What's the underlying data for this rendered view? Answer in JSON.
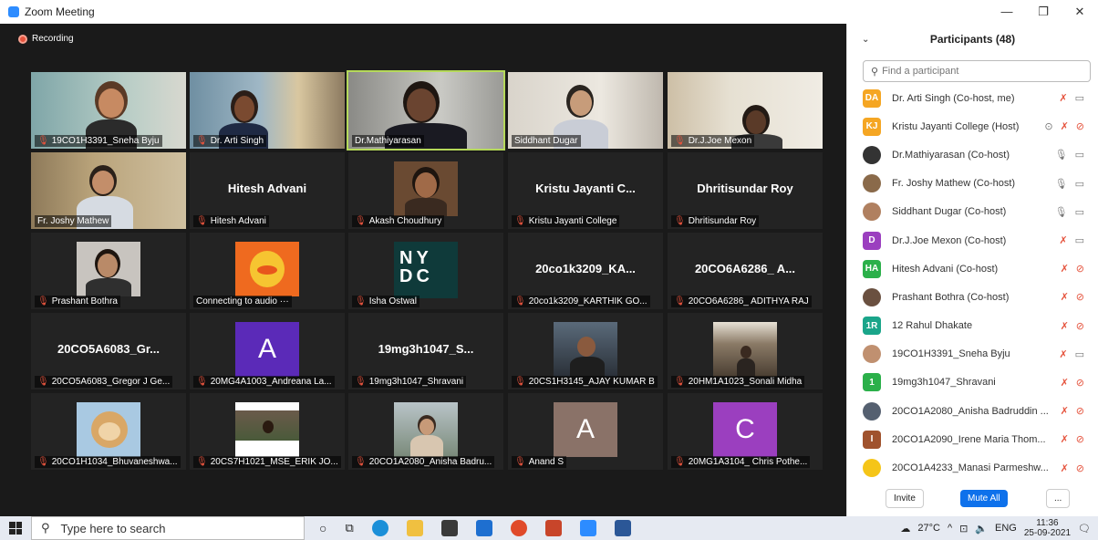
{
  "window": {
    "title": "Zoom Meeting",
    "controls": [
      "—",
      "❐",
      "✕"
    ]
  },
  "recording_label": "Recording",
  "tiles": [
    {
      "label": "19CO1H3391_Sneha Byju",
      "muted": true
    },
    {
      "label": "Dr. Arti Singh",
      "muted": true
    },
    {
      "label": "Dr.Mathiyarasan",
      "muted": false,
      "active": true
    },
    {
      "label": "Siddhant Dugar",
      "muted": false
    },
    {
      "label": "Dr.J.Joe Mexon",
      "muted": true
    },
    {
      "label": "Fr. Joshy Mathew",
      "muted": false
    },
    {
      "center": "Hitesh Advani",
      "label": "Hitesh Advani",
      "muted": true
    },
    {
      "label": "Akash Choudhury",
      "muted": true
    },
    {
      "center": "Kristu Jayanti C...",
      "label": "Kristu Jayanti College",
      "muted": true
    },
    {
      "center": "Dhritisundar Roy",
      "label": "Dhritisundar Roy",
      "muted": true
    },
    {
      "label": "Prashant Bothra",
      "muted": true
    },
    {
      "label": "Connecting to audio ···",
      "muted": false
    },
    {
      "nydc": "NY DC",
      "label": "Isha Ostwal",
      "muted": true
    },
    {
      "center": "20co1k3209_KA...",
      "label": "20co1k3209_KARTHIK GO...",
      "muted": true
    },
    {
      "center": "20CO6A6286_ A...",
      "label": "20CO6A6286_ ADITHYA RAJ",
      "muted": true
    },
    {
      "center": "20CO5A6083_Gr...",
      "label": "20CO5A6083_Gregor J Ge...",
      "muted": true
    },
    {
      "letter": "A",
      "label": "20MG4A1003_Andreana La...",
      "muted": true
    },
    {
      "center": "19mg3h1047_S...",
      "label": "19mg3h1047_Shravani",
      "muted": true
    },
    {
      "label": "20CS1H3145_AJAY KUMAR B",
      "muted": true
    },
    {
      "label": "20HM1A1023_Sonali Midha",
      "muted": true
    },
    {
      "label": "20CO1H1034_Bhuvaneshwa...",
      "muted": true
    },
    {
      "label": "20CS7H1021_MSE_ERIK JO...",
      "muted": true
    },
    {
      "label": "20CO1A2080_Anisha Badru...",
      "muted": true
    },
    {
      "letter": "A",
      "label": "Anand S",
      "muted": true
    },
    {
      "letter": "C",
      "label": "20MG1A3104_ Chris Pothe...",
      "muted": true
    }
  ],
  "panel": {
    "title": "Participants (48)",
    "search_placeholder": "Find a participant",
    "participants": [
      {
        "initials": "DA",
        "color": "#f5a623",
        "name": "Dr. Arti Singh (Co-host, me)",
        "mic": "muted",
        "video": "on"
      },
      {
        "initials": "KJ",
        "color": "#f5a623",
        "name": "Kristu Jayanti College (Host)",
        "mic": "muted",
        "video": "off",
        "share": true
      },
      {
        "initials": "",
        "color": "#333333",
        "name": "Dr.Mathiyarasan (Co-host)",
        "mic": "on",
        "video": "on",
        "photo": true
      },
      {
        "initials": "",
        "color": "#8a6a4a",
        "name": "Fr. Joshy Mathew (Co-host)",
        "mic": "on",
        "video": "on",
        "photo": true
      },
      {
        "initials": "",
        "color": "#b08060",
        "name": "Siddhant Dugar (Co-host)",
        "mic": "on",
        "video": "on",
        "photo": true
      },
      {
        "initials": "D",
        "color": "#9b3fbf",
        "name": "Dr.J.Joe Mexon (Co-host)",
        "mic": "muted",
        "video": "on"
      },
      {
        "initials": "HA",
        "color": "#2bb04a",
        "name": "Hitesh Advani (Co-host)",
        "mic": "muted",
        "video": "off"
      },
      {
        "initials": "",
        "color": "#6a5040",
        "name": "Prashant Bothra (Co-host)",
        "mic": "muted",
        "video": "off",
        "photo": true
      },
      {
        "initials": "1R",
        "color": "#1aa58a",
        "name": "12 Rahul Dhakate",
        "mic": "muted",
        "video": "off"
      },
      {
        "initials": "",
        "color": "#c09070",
        "name": "19CO1H3391_Sneha Byju",
        "mic": "muted",
        "video": "on",
        "photo": true
      },
      {
        "initials": "1",
        "color": "#2bb04a",
        "name": "19mg3h1047_Shravani",
        "mic": "muted",
        "video": "off"
      },
      {
        "initials": "",
        "color": "#556070",
        "name": "20CO1A2080_Anisha Badruddin ...",
        "mic": "muted",
        "video": "off",
        "photo": true
      },
      {
        "initials": "I",
        "color": "#a0522d",
        "name": "20CO1A2090_Irene Maria Thom...",
        "mic": "muted",
        "video": "off"
      },
      {
        "initials": "",
        "color": "#f5c518",
        "name": "20CO1A4233_Manasi Parmeshw...",
        "mic": "muted",
        "video": "off",
        "photo": true
      }
    ],
    "invite_label": "Invite",
    "mute_all_label": "Mute All",
    "more_label": "..."
  },
  "taskbar": {
    "search_placeholder": "Type here to search",
    "weather": "27°C",
    "lang": "ENG",
    "time": "11:36",
    "date": "25-09-2021"
  }
}
